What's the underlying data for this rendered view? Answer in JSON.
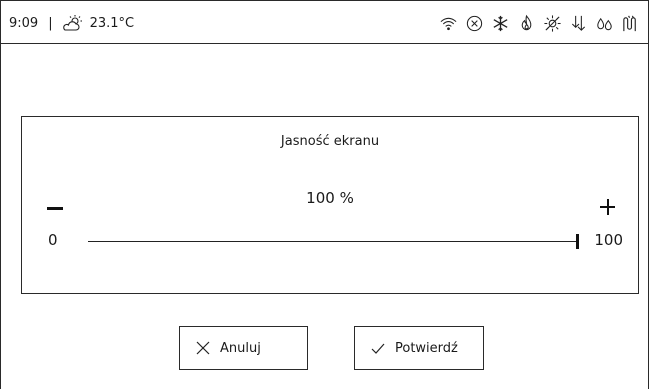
{
  "status_bar": {
    "time": "9:09",
    "separator": "|",
    "temperature": "23.1°C",
    "weather_icon": "partly-sunny-icon",
    "icons": [
      "wifi-icon",
      "circle-x-icon",
      "snowflake-icon",
      "flame-icon",
      "sun-crossed-icon",
      "arrows-down-icon",
      "droplets-icon",
      "heating-coil-icon"
    ]
  },
  "dialog": {
    "title": "Jasność ekranu",
    "value_display": "100 %",
    "minus_label": "−",
    "plus_label": "+",
    "slider": {
      "min_label": "0",
      "max_label": "100",
      "min": 0,
      "max": 100,
      "value": 100
    }
  },
  "buttons": {
    "cancel_label": "Anuluj",
    "confirm_label": "Potwierdź"
  }
}
